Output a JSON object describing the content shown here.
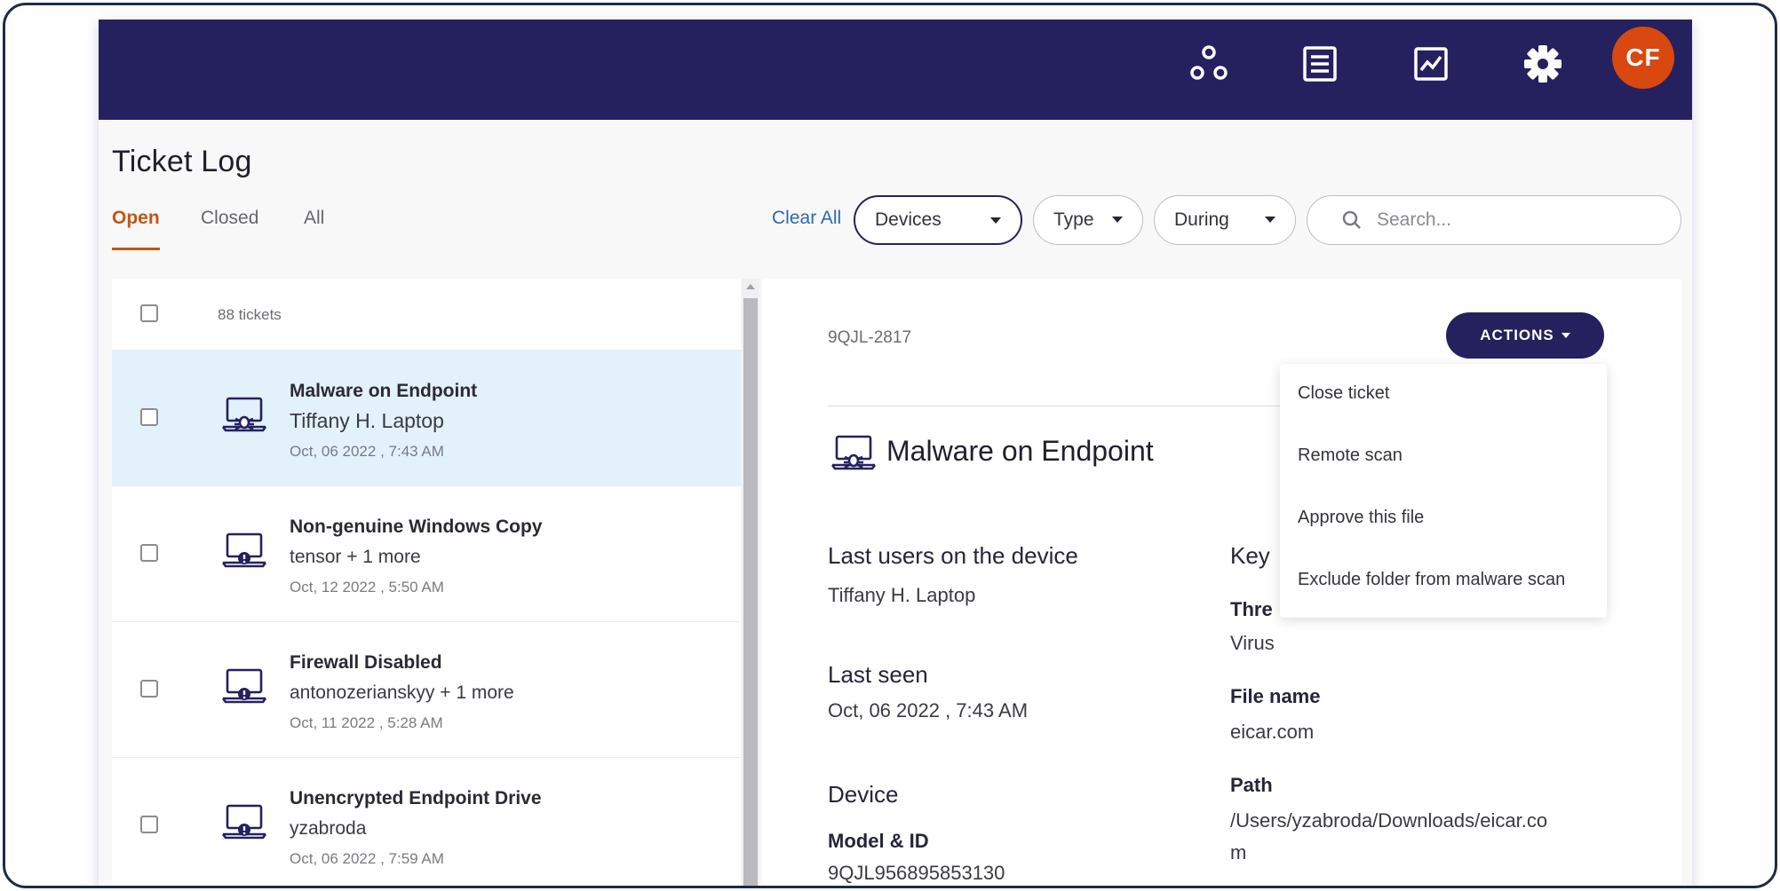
{
  "header": {
    "icons": [
      "network-icon",
      "list-icon",
      "chart-icon",
      "gear-icon"
    ],
    "avatar_initials": "CF",
    "brand_color": "#25215e",
    "avatar_color": "#d9480f"
  },
  "page": {
    "title": "Ticket Log",
    "tabs": [
      {
        "label": "Open",
        "active": true
      },
      {
        "label": "Closed",
        "active": false
      },
      {
        "label": "All",
        "active": false
      }
    ],
    "accent_color": "#c4550f"
  },
  "filters": {
    "clear_all": "Clear All",
    "devices": "Devices",
    "type": "Type",
    "during": "During",
    "search_placeholder": "Search..."
  },
  "list": {
    "count_label": "88 tickets",
    "tickets": [
      {
        "title": "Malware on Endpoint",
        "subtitle": "Tiffany H. Laptop",
        "date": "Oct, 06 2022 , 7:43 AM",
        "icon": "malware-laptop-icon",
        "selected": true
      },
      {
        "title": "Non-genuine Windows Copy",
        "subtitle": "tensor + 1 more",
        "date": "Oct, 12 2022 , 5:50 AM",
        "icon": "alert-laptop-icon",
        "selected": false
      },
      {
        "title": "Firewall Disabled",
        "subtitle": "antonozerianskyy + 1 more",
        "date": "Oct, 11 2022 , 5:28 AM",
        "icon": "alert-laptop-icon",
        "selected": false
      },
      {
        "title": "Unencrypted Endpoint Drive",
        "subtitle": "yzabroda",
        "date": "Oct, 06 2022 , 7:59 AM",
        "icon": "alert-laptop-icon",
        "selected": false
      }
    ]
  },
  "detail": {
    "id": "9QJL-2817",
    "actions_label": "ACTIONS",
    "title": "Malware on Endpoint",
    "last_users_label": "Last users on the device",
    "last_users_value": "Tiffany H. Laptop",
    "last_seen_label": "Last seen",
    "last_seen_value": "Oct, 06 2022 , 7:43 AM",
    "device_label": "Device",
    "model_label": "Model & ID",
    "model_value": "9QJL956895853130",
    "key_label": "Key",
    "threat_label": "Thre",
    "threat_value": "Virus",
    "file_name_label": "File name",
    "file_name_value": "eicar.com",
    "path_label": "Path",
    "path_line1": "/Users/yzabroda/Downloads/eicar.co",
    "path_line2": "m"
  },
  "actions_menu": {
    "items": [
      "Close ticket",
      "Remote scan",
      "Approve this file",
      "Exclude folder from malware scan"
    ]
  }
}
